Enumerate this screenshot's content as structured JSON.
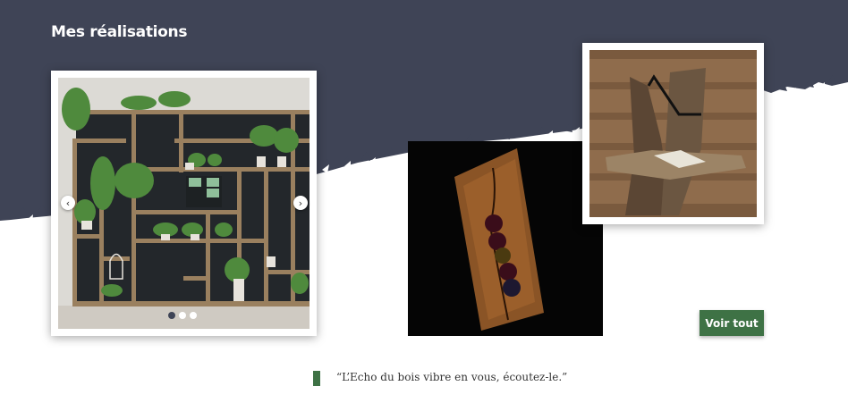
{
  "section": {
    "title": "Mes réalisations"
  },
  "carousel": {
    "prev_icon": "‹",
    "next_icon": "›",
    "slide_count": 3,
    "active_slide": 1
  },
  "gallery": {
    "items": [
      {
        "name": "shelf-with-plants-photo",
        "description": "wooden shelving unit with plants"
      },
      {
        "name": "wine-rack-photo",
        "description": "wooden wine bottle holder on black background"
      },
      {
        "name": "driftwood-desk-photo",
        "description": "driftwood shelf with open book"
      }
    ]
  },
  "actions": {
    "view_all_label": "Voir tout"
  },
  "quote": {
    "text": "“L’Echo du bois vibre en vous, écoutez-le.”"
  },
  "colors": {
    "banner": "#3f4456",
    "accent_green": "#3e7245",
    "background": "#ffffff"
  }
}
